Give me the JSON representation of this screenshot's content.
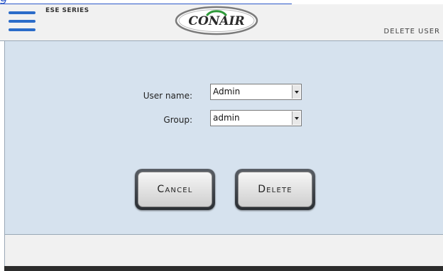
{
  "header": {
    "series_label": "ESE SERIES",
    "logo_text": "CONAIR",
    "screen_title": "DELETE USER",
    "menu_icon": "hamburger-menu-icon"
  },
  "top_fragment": {
    "text": "g"
  },
  "form": {
    "username": {
      "label": "User name:",
      "value": "Admin"
    },
    "group": {
      "label": "Group:",
      "value": "admin"
    }
  },
  "actions": {
    "cancel_label": "Cancel",
    "delete_label": "Delete"
  },
  "colors": {
    "accent": "#2b6cc9",
    "panel_bg": "#d6e2ee",
    "header_bg": "#f1f1f1",
    "logo_green": "#2f9a3a"
  }
}
